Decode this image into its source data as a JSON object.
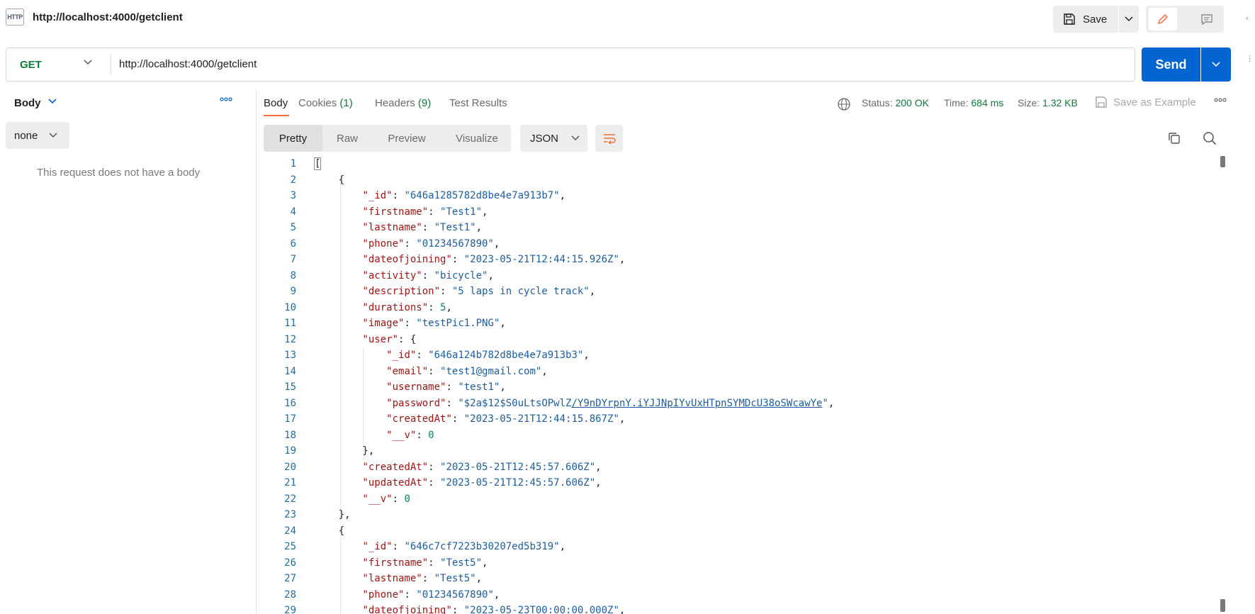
{
  "request": {
    "title": "http://localhost:4000/getclient",
    "method": "GET",
    "url": "http://localhost:4000/getclient"
  },
  "toolbar": {
    "http_badge": "HTTP",
    "save_label": "Save",
    "send_label": "Send"
  },
  "left_pane": {
    "tab_label": "Body",
    "body_type": "none",
    "empty_message": "This request does not have a body"
  },
  "response": {
    "tabs": [
      {
        "label": "Body",
        "count": ""
      },
      {
        "label": "Cookies",
        "count": "(1)"
      },
      {
        "label": "Headers",
        "count": "(9)"
      },
      {
        "label": "Test Results",
        "count": ""
      }
    ],
    "status_label": "Status:",
    "status_value": "200 OK",
    "time_label": "Time:",
    "time_value": "684 ms",
    "size_label": "Size:",
    "size_value": "1.32 KB",
    "save_example_label": "Save as Example",
    "formats": [
      "Pretty",
      "Raw",
      "Preview",
      "Visualize"
    ],
    "language": "JSON"
  },
  "colors": {
    "send": "#0265d2",
    "method_get": "#0c7d3c",
    "active_tab_underline": "#ff6c37"
  },
  "editor": {
    "lines": [
      [
        {
          "t": "p",
          "v": "["
        }
      ],
      [
        {
          "t": "p",
          "v": "    {"
        }
      ],
      [
        {
          "t": "p",
          "v": "        "
        },
        {
          "t": "k",
          "v": "\"_id\""
        },
        {
          "t": "p",
          "v": ": "
        },
        {
          "t": "s",
          "v": "\"646a1285782d8be4e7a913b7\""
        },
        {
          "t": "p",
          "v": ","
        }
      ],
      [
        {
          "t": "p",
          "v": "        "
        },
        {
          "t": "k",
          "v": "\"firstname\""
        },
        {
          "t": "p",
          "v": ": "
        },
        {
          "t": "s",
          "v": "\"Test1\""
        },
        {
          "t": "p",
          "v": ","
        }
      ],
      [
        {
          "t": "p",
          "v": "        "
        },
        {
          "t": "k",
          "v": "\"lastname\""
        },
        {
          "t": "p",
          "v": ": "
        },
        {
          "t": "s",
          "v": "\"Test1\""
        },
        {
          "t": "p",
          "v": ","
        }
      ],
      [
        {
          "t": "p",
          "v": "        "
        },
        {
          "t": "k",
          "v": "\"phone\""
        },
        {
          "t": "p",
          "v": ": "
        },
        {
          "t": "s",
          "v": "\"01234567890\""
        },
        {
          "t": "p",
          "v": ","
        }
      ],
      [
        {
          "t": "p",
          "v": "        "
        },
        {
          "t": "k",
          "v": "\"dateofjoining\""
        },
        {
          "t": "p",
          "v": ": "
        },
        {
          "t": "s",
          "v": "\"2023-05-21T12:44:15.926Z\""
        },
        {
          "t": "p",
          "v": ","
        }
      ],
      [
        {
          "t": "p",
          "v": "        "
        },
        {
          "t": "k",
          "v": "\"activity\""
        },
        {
          "t": "p",
          "v": ": "
        },
        {
          "t": "s",
          "v": "\"bicycle\""
        },
        {
          "t": "p",
          "v": ","
        }
      ],
      [
        {
          "t": "p",
          "v": "        "
        },
        {
          "t": "k",
          "v": "\"description\""
        },
        {
          "t": "p",
          "v": ": "
        },
        {
          "t": "s",
          "v": "\"5 laps in cycle track\""
        },
        {
          "t": "p",
          "v": ","
        }
      ],
      [
        {
          "t": "p",
          "v": "        "
        },
        {
          "t": "k",
          "v": "\"durations\""
        },
        {
          "t": "p",
          "v": ": "
        },
        {
          "t": "n",
          "v": "5"
        },
        {
          "t": "p",
          "v": ","
        }
      ],
      [
        {
          "t": "p",
          "v": "        "
        },
        {
          "t": "k",
          "v": "\"image\""
        },
        {
          "t": "p",
          "v": ": "
        },
        {
          "t": "s",
          "v": "\"testPic1.PNG\""
        },
        {
          "t": "p",
          "v": ","
        }
      ],
      [
        {
          "t": "p",
          "v": "        "
        },
        {
          "t": "k",
          "v": "\"user\""
        },
        {
          "t": "p",
          "v": ": {"
        }
      ],
      [
        {
          "t": "p",
          "v": "            "
        },
        {
          "t": "k",
          "v": "\"_id\""
        },
        {
          "t": "p",
          "v": ": "
        },
        {
          "t": "s",
          "v": "\"646a124b782d8be4e7a913b3\""
        },
        {
          "t": "p",
          "v": ","
        }
      ],
      [
        {
          "t": "p",
          "v": "            "
        },
        {
          "t": "k",
          "v": "\"email\""
        },
        {
          "t": "p",
          "v": ": "
        },
        {
          "t": "s",
          "v": "\"test1@gmail.com\""
        },
        {
          "t": "p",
          "v": ","
        }
      ],
      [
        {
          "t": "p",
          "v": "            "
        },
        {
          "t": "k",
          "v": "\"username\""
        },
        {
          "t": "p",
          "v": ": "
        },
        {
          "t": "s",
          "v": "\"test1\""
        },
        {
          "t": "p",
          "v": ","
        }
      ],
      [
        {
          "t": "p",
          "v": "            "
        },
        {
          "t": "k",
          "v": "\"password\""
        },
        {
          "t": "p",
          "v": ": "
        },
        {
          "t": "s",
          "v": "\"$2a$12$S0uLtsOPwlZ"
        },
        {
          "t": "su",
          "v": "/Y9nDYrpnY.iYJJNpIYvUxHTpnSYMDcU38oSWcawYe"
        },
        {
          "t": "s",
          "v": "\""
        },
        {
          "t": "p",
          "v": ","
        }
      ],
      [
        {
          "t": "p",
          "v": "            "
        },
        {
          "t": "k",
          "v": "\"createdAt\""
        },
        {
          "t": "p",
          "v": ": "
        },
        {
          "t": "s",
          "v": "\"2023-05-21T12:44:15.867Z\""
        },
        {
          "t": "p",
          "v": ","
        }
      ],
      [
        {
          "t": "p",
          "v": "            "
        },
        {
          "t": "k",
          "v": "\"__v\""
        },
        {
          "t": "p",
          "v": ": "
        },
        {
          "t": "n",
          "v": "0"
        }
      ],
      [
        {
          "t": "p",
          "v": "        },"
        }
      ],
      [
        {
          "t": "p",
          "v": "        "
        },
        {
          "t": "k",
          "v": "\"createdAt\""
        },
        {
          "t": "p",
          "v": ": "
        },
        {
          "t": "s",
          "v": "\"2023-05-21T12:45:57.606Z\""
        },
        {
          "t": "p",
          "v": ","
        }
      ],
      [
        {
          "t": "p",
          "v": "        "
        },
        {
          "t": "k",
          "v": "\"updatedAt\""
        },
        {
          "t": "p",
          "v": ": "
        },
        {
          "t": "s",
          "v": "\"2023-05-21T12:45:57.606Z\""
        },
        {
          "t": "p",
          "v": ","
        }
      ],
      [
        {
          "t": "p",
          "v": "        "
        },
        {
          "t": "k",
          "v": "\"__v\""
        },
        {
          "t": "p",
          "v": ": "
        },
        {
          "t": "n",
          "v": "0"
        }
      ],
      [
        {
          "t": "p",
          "v": "    },"
        }
      ],
      [
        {
          "t": "p",
          "v": "    {"
        }
      ],
      [
        {
          "t": "p",
          "v": "        "
        },
        {
          "t": "k",
          "v": "\"_id\""
        },
        {
          "t": "p",
          "v": ": "
        },
        {
          "t": "s",
          "v": "\"646c7cf7223b30207ed5b319\""
        },
        {
          "t": "p",
          "v": ","
        }
      ],
      [
        {
          "t": "p",
          "v": "        "
        },
        {
          "t": "k",
          "v": "\"firstname\""
        },
        {
          "t": "p",
          "v": ": "
        },
        {
          "t": "s",
          "v": "\"Test5\""
        },
        {
          "t": "p",
          "v": ","
        }
      ],
      [
        {
          "t": "p",
          "v": "        "
        },
        {
          "t": "k",
          "v": "\"lastname\""
        },
        {
          "t": "p",
          "v": ": "
        },
        {
          "t": "s",
          "v": "\"Test5\""
        },
        {
          "t": "p",
          "v": ","
        }
      ],
      [
        {
          "t": "p",
          "v": "        "
        },
        {
          "t": "k",
          "v": "\"phone\""
        },
        {
          "t": "p",
          "v": ": "
        },
        {
          "t": "s",
          "v": "\"01234567890\""
        },
        {
          "t": "p",
          "v": ","
        }
      ],
      [
        {
          "t": "p",
          "v": "        "
        },
        {
          "t": "k",
          "v": "\"dateofjoining\""
        },
        {
          "t": "p",
          "v": ": "
        },
        {
          "t": "s",
          "v": "\"2023-05-23T00:00:00.000Z\""
        },
        {
          "t": "p",
          "v": ","
        }
      ]
    ]
  }
}
